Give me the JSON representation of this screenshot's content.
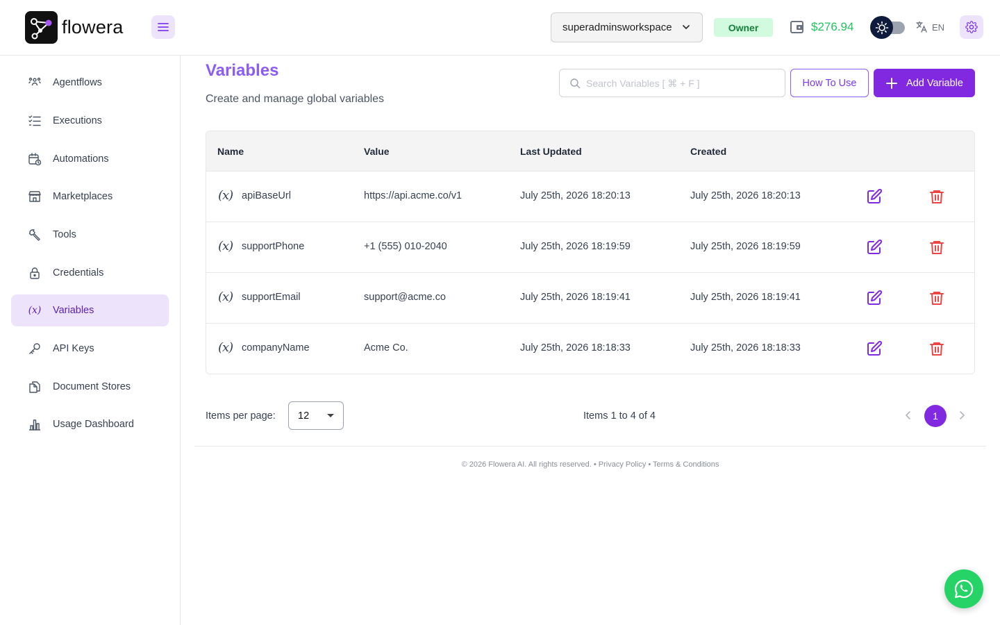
{
  "header": {
    "brand": "flowera",
    "workspace": "superadminsworkspace",
    "role": "Owner",
    "balance": "$276.94",
    "language": "EN"
  },
  "sidebar": {
    "items": [
      {
        "label": "Agentflows",
        "icon": "agentflows-icon"
      },
      {
        "label": "Executions",
        "icon": "executions-icon"
      },
      {
        "label": "Automations",
        "icon": "calendar-icon"
      },
      {
        "label": "Marketplaces",
        "icon": "store-icon"
      },
      {
        "label": "Tools",
        "icon": "tool-icon"
      },
      {
        "label": "Credentials",
        "icon": "lock-icon"
      },
      {
        "label": "Variables",
        "icon": "variable-icon",
        "active": true
      },
      {
        "label": "API Keys",
        "icon": "key-icon"
      },
      {
        "label": "Document Stores",
        "icon": "files-icon"
      },
      {
        "label": "Usage Dashboard",
        "icon": "chart-icon"
      }
    ]
  },
  "main": {
    "title": "Variables",
    "subtitle": "Create and manage global variables",
    "search_placeholder": "Search Variables [ ⌘ + F ]",
    "how_to_use": "How To Use",
    "add_variable": "Add Variable"
  },
  "table": {
    "headers": {
      "name": "Name",
      "value": "Value",
      "updated": "Last Updated",
      "created": "Created"
    },
    "rows": [
      {
        "name": "apiBaseUrl",
        "value": "https://api.acme.co/v1",
        "updated": "July 25th, 2026 18:20:13",
        "created": "July 25th, 2026 18:20:13"
      },
      {
        "name": "supportPhone",
        "value": "+1 (555) 010-2040",
        "updated": "July 25th, 2026 18:19:59",
        "created": "July 25th, 2026 18:19:59"
      },
      {
        "name": "supportEmail",
        "value": "support@acme.co",
        "updated": "July 25th, 2026 18:19:41",
        "created": "July 25th, 2026 18:19:41"
      },
      {
        "name": "companyName",
        "value": "Acme Co.",
        "updated": "July 25th, 2026 18:18:33",
        "created": "July 25th, 2026 18:18:33"
      }
    ]
  },
  "pagination": {
    "items_per_page_label": "Items per page:",
    "items_per_page": "12",
    "summary": "Items 1 to 4 of 4",
    "current_page": "1"
  },
  "footer": {
    "text": "© 2026 Flowera AI. All rights reserved. • Privacy Policy • Terms & Conditions"
  },
  "colors": {
    "accent": "#8129e0",
    "title": "#8b5cf6",
    "owner_badge_bg": "#d1fadf",
    "balance": "#22c55e",
    "delete": "#ef4444",
    "chat": "#25d366"
  }
}
